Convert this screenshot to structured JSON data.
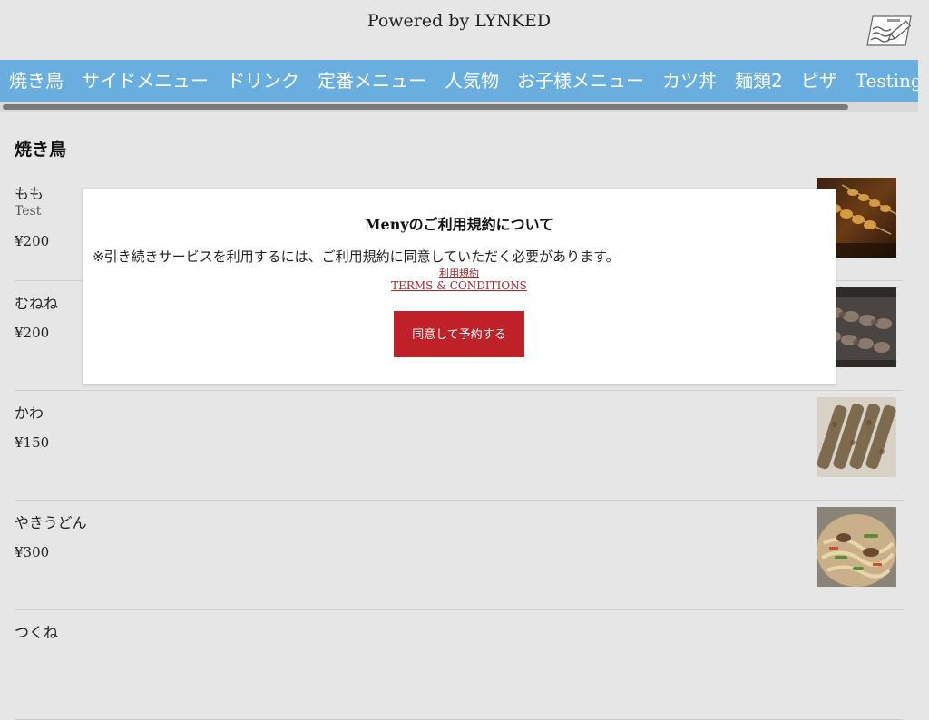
{
  "header": {
    "brand": "Powered by LYNKED",
    "memo_icon": "memo-pencil-icon"
  },
  "categories": [
    {
      "label": "焼き鳥"
    },
    {
      "label": "サイドメニュー"
    },
    {
      "label": "ドリンク"
    },
    {
      "label": "定番メニュー"
    },
    {
      "label": "人気物"
    },
    {
      "label": "お子様メニュー"
    },
    {
      "label": "カツ丼"
    },
    {
      "label": "麺類2"
    },
    {
      "label": "ピザ"
    },
    {
      "label": "Testing"
    }
  ],
  "section": {
    "title": "焼き鳥"
  },
  "items": [
    {
      "name": "もも",
      "desc": "Test",
      "price": "¥200"
    },
    {
      "name": "むねね",
      "desc": "",
      "price": "¥200"
    },
    {
      "name": "かわ",
      "desc": "",
      "price": "¥150"
    },
    {
      "name": "やきうどん",
      "desc": "",
      "price": "¥300"
    },
    {
      "name": "つくね",
      "desc": "",
      "price": ""
    }
  ],
  "modal": {
    "title": "Menyのご利用規約について",
    "notice": "※引き続きサービスを利用するには、ご利用規約に同意していただく必要があります。",
    "terms_link_ja": "利用規約",
    "terms_link_en": "TERMS & CONDITIONS",
    "agree_button": "同意して予約する"
  },
  "colors": {
    "nav_bg": "#6aaee0",
    "button_red": "#bf2128",
    "link_red": "#b0242a"
  }
}
